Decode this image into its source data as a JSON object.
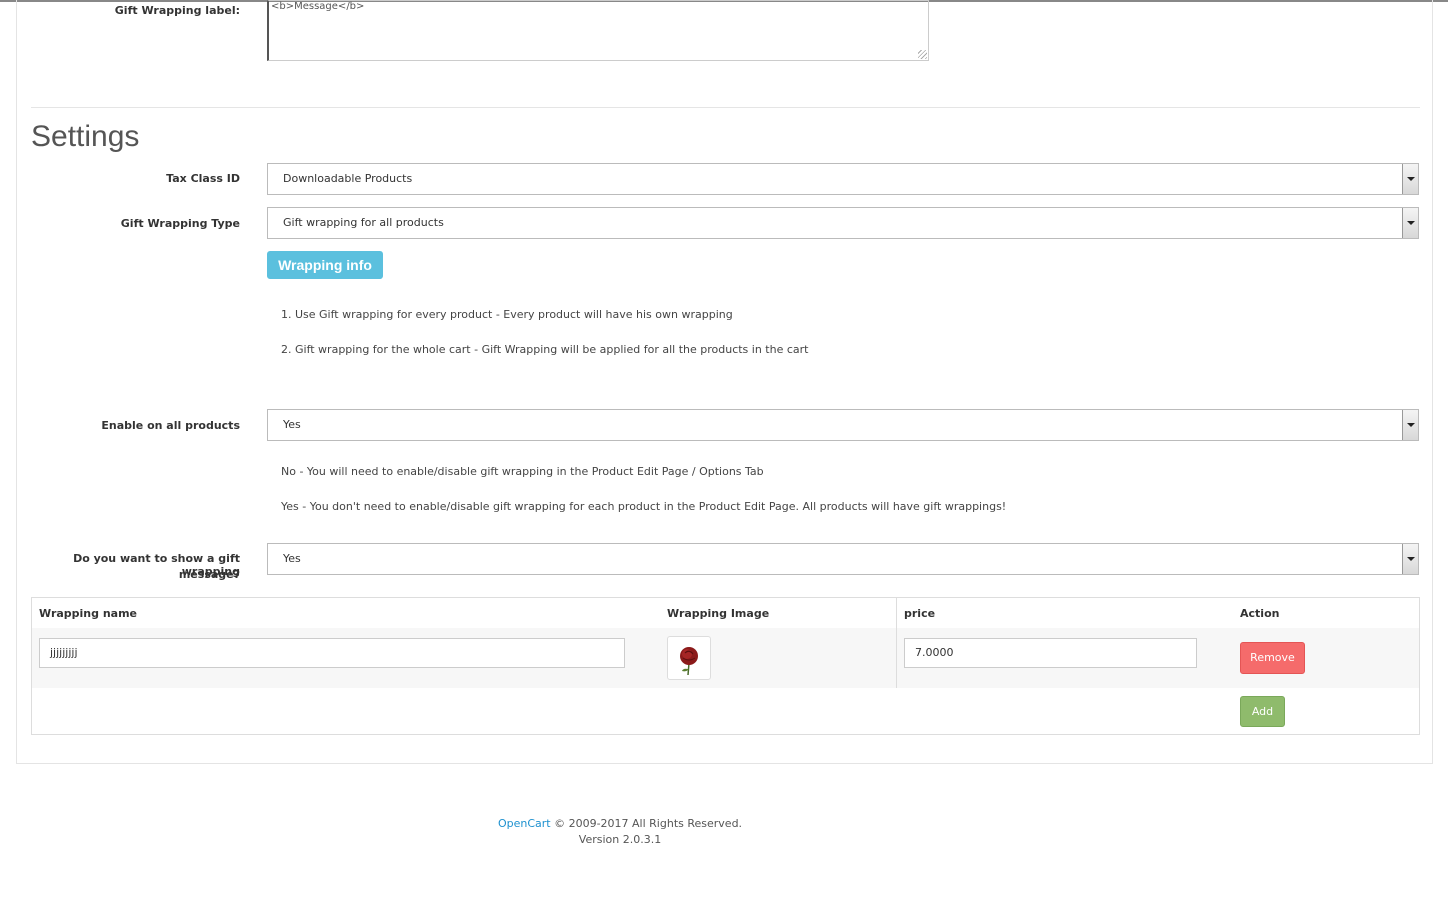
{
  "gift_label": {
    "label": "Gift Wrapping label:",
    "value": "<b>Message</b>"
  },
  "settings": {
    "title": "Settings",
    "tax_class": {
      "label": "Tax Class ID",
      "value": "Downloadable Products"
    },
    "wrapping_type": {
      "label": "Gift Wrapping Type",
      "value": "Gift wrapping for all products"
    },
    "wrapping_info_button": "Wrapping info",
    "wrapping_info_lines": [
      "1. Use Gift wrapping for every product - Every product will have his own wrapping",
      "2. Gift wrapping for the whole cart - Gift Wrapping will be applied for all the products in the cart"
    ],
    "enable_all": {
      "label": "Enable on all products",
      "value": "Yes"
    },
    "enable_info_lines": [
      "No - You will need to enable/disable gift wrapping in the Product Edit Page / Options Tab",
      "Yes - You don't need to enable/disable gift wrapping for each product in the Product Edit Page. All products will have gift wrappings!"
    ],
    "show_message": {
      "label_line1": "Do you want to show a gift wrapping",
      "label_line2": "message?",
      "value": "Yes"
    }
  },
  "wrappings_table": {
    "headers": {
      "name": "Wrapping name",
      "image": "Wrapping Image",
      "price": "price",
      "action": "Action"
    },
    "rows": [
      {
        "name": "jjjjjjjjj",
        "image_icon": "rose-thumbnail-icon",
        "price": "7.0000",
        "remove_label": "Remove"
      }
    ],
    "add_label": "Add"
  },
  "footer": {
    "link_text": "OpenCart",
    "copyright": " © 2009-2017 All Rights Reserved.",
    "version": "Version 2.0.3.1"
  },
  "colors": {
    "info": "#5bc0de",
    "danger": "#f56b6b",
    "success": "#8fbb6c",
    "link": "#1e91cf"
  }
}
